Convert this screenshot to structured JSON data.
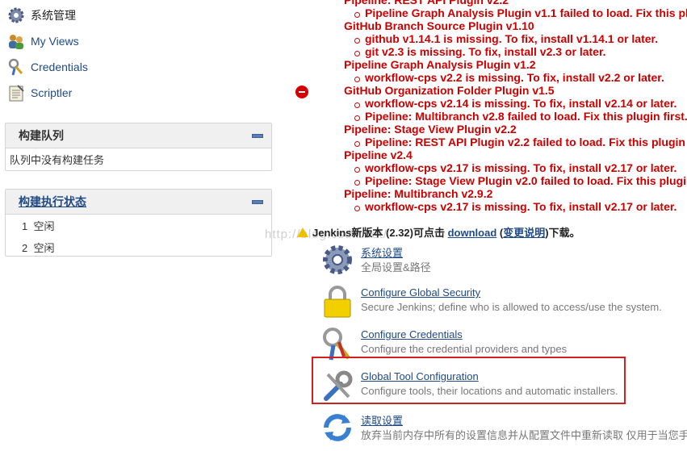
{
  "sidebar": {
    "items": [
      {
        "label": "系统管理",
        "icon": "gear-icon"
      },
      {
        "label": "My Views",
        "icon": "users-icon"
      },
      {
        "label": "Credentials",
        "icon": "keys-icon"
      },
      {
        "label": "Scriptler",
        "icon": "notepad-icon"
      }
    ],
    "build_queue": {
      "title": "构建队列",
      "empty_text": "队列中没有构建任务"
    },
    "executor_status": {
      "title": "构建执行状态",
      "rows": [
        {
          "num": "1",
          "state": "空闲"
        },
        {
          "num": "2",
          "state": "空闲"
        }
      ]
    }
  },
  "errors": {
    "lines": [
      {
        "kind": "head",
        "text": "Pipeline: REST API Plugin v2.2"
      },
      {
        "kind": "sub",
        "text": "Pipeline Graph Analysis Plugin v1.1 failed to load. Fix this pl"
      },
      {
        "kind": "head",
        "text": "GitHub Branch Source Plugin v1.10"
      },
      {
        "kind": "sub",
        "text": "github v1.14.1 is missing. To fix, install v1.14.1 or later."
      },
      {
        "kind": "sub",
        "text": "git v2.3 is missing. To fix, install v2.3 or later."
      },
      {
        "kind": "head",
        "text": "Pipeline Graph Analysis Plugin v1.2"
      },
      {
        "kind": "sub",
        "text": "workflow-cps v2.2 is missing. To fix, install v2.2 or later."
      },
      {
        "kind": "head",
        "text": "GitHub Organization Folder Plugin v1.5"
      },
      {
        "kind": "sub",
        "text": "workflow-cps v2.14 is missing. To fix, install v2.14 or later."
      },
      {
        "kind": "sub",
        "text": "Pipeline: Multibranch v2.8 failed to load. Fix this plugin first."
      },
      {
        "kind": "head",
        "text": "Pipeline: Stage View Plugin v2.2"
      },
      {
        "kind": "sub",
        "text": "Pipeline: REST API Plugin v2.2 failed to load. Fix this plugin"
      },
      {
        "kind": "head",
        "text": "Pipeline v2.4"
      },
      {
        "kind": "sub",
        "text": "workflow-cps v2.17 is missing. To fix, install v2.17 or later."
      },
      {
        "kind": "sub",
        "text": "Pipeline: Stage View Plugin v2.0 failed to load. Fix this plugi"
      },
      {
        "kind": "head",
        "text": "Pipeline: Multibranch v2.9.2"
      },
      {
        "kind": "sub",
        "text": "workflow-cps v2.17 is missing. To fix, install v2.17 or later."
      }
    ]
  },
  "notice": {
    "prefix": "Jenkins新版本 (2.32)可点击 ",
    "download": "download",
    "paren_open": " (",
    "changelog": "变更说明",
    "suffix": ")下载。"
  },
  "watermark": "http://blog.csdn.net/",
  "manage": [
    {
      "title": "系统设置",
      "desc": "全局设置&路径",
      "icon": "gear-icon"
    },
    {
      "title": "Configure Global Security",
      "desc": "Secure Jenkins; define who is allowed to access/use the system.",
      "icon": "lock-icon"
    },
    {
      "title": "Configure Credentials",
      "desc": "Configure the credential providers and types",
      "icon": "keys-icon"
    },
    {
      "title": "Global Tool Configuration",
      "desc": "Configure tools, their locations and automatic installers.",
      "icon": "tools-icon"
    },
    {
      "title": "读取设置",
      "desc": "放弃当前内存中所有的设置信息并从配置文件中重新读取 仅用于当您手",
      "icon": "reload-icon"
    }
  ]
}
